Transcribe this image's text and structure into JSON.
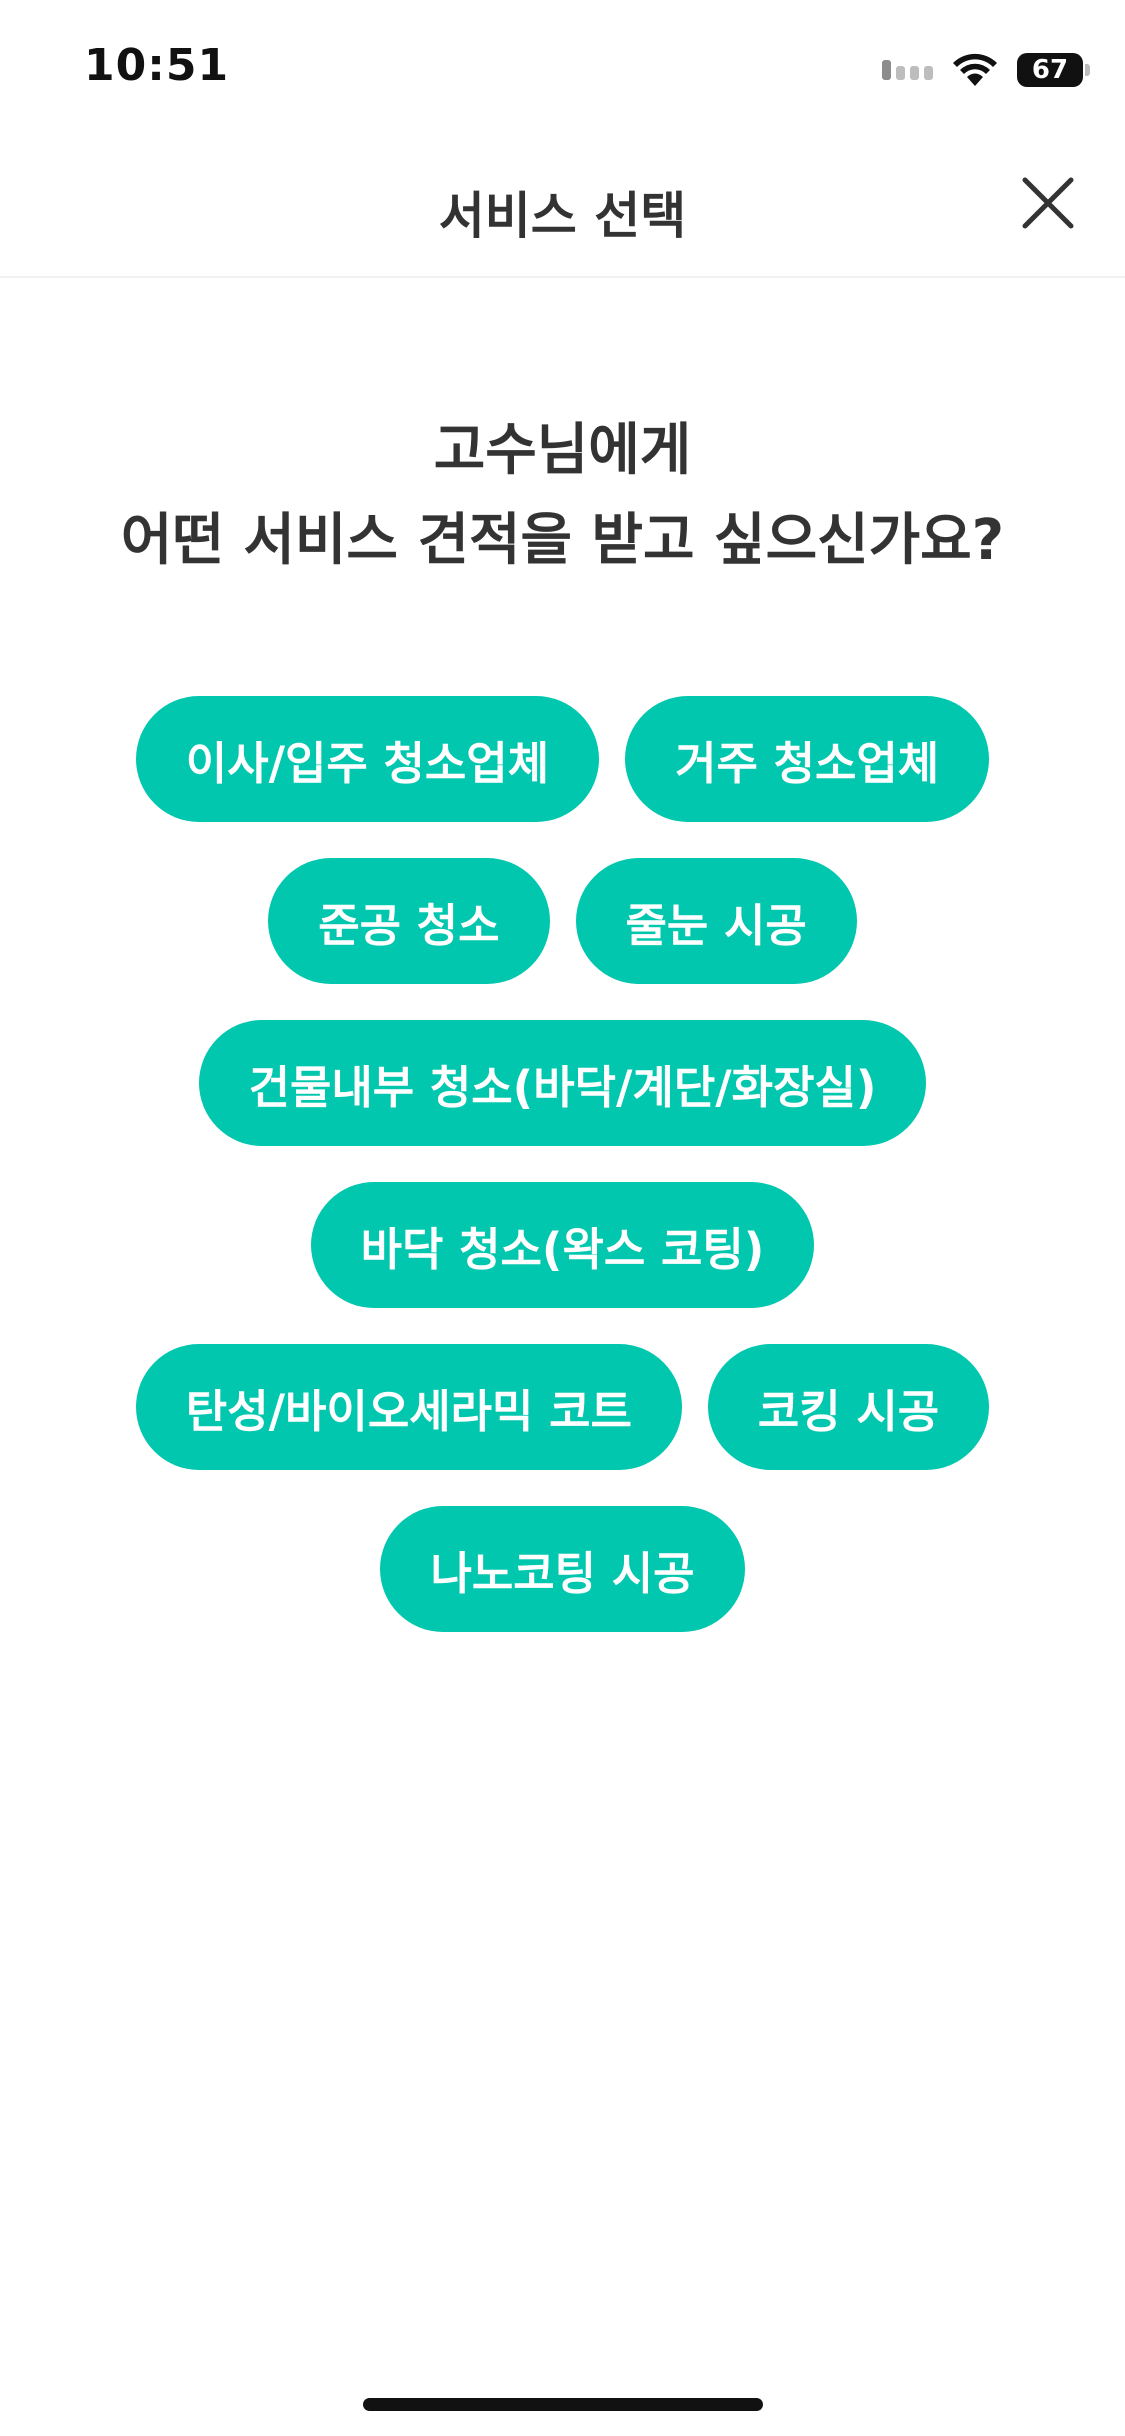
{
  "status_bar": {
    "time": "10:51",
    "battery": "67",
    "icons": [
      "signal-icon",
      "wifi-icon",
      "battery-icon"
    ]
  },
  "header": {
    "title": "서비스 선택",
    "close_icon": "close-icon"
  },
  "question": {
    "line1": "고수님에게",
    "line2": "어떤 서비스 견적을 받고 싶으신가요?"
  },
  "services": [
    [
      "이사/입주 청소업체",
      "거주 청소업체"
    ],
    [
      "준공 청소",
      "줄눈 시공"
    ],
    [
      "건물내부 청소(바닥/계단/화장실)"
    ],
    [
      "바닥 청소(왁스 코팅)"
    ],
    [
      "탄성/바이오세라믹 코트",
      "코킹 시공"
    ],
    [
      "나노코팅 시공"
    ]
  ],
  "colors": {
    "accent": "#00c7ae",
    "text": "#333333",
    "background": "#ffffff"
  }
}
